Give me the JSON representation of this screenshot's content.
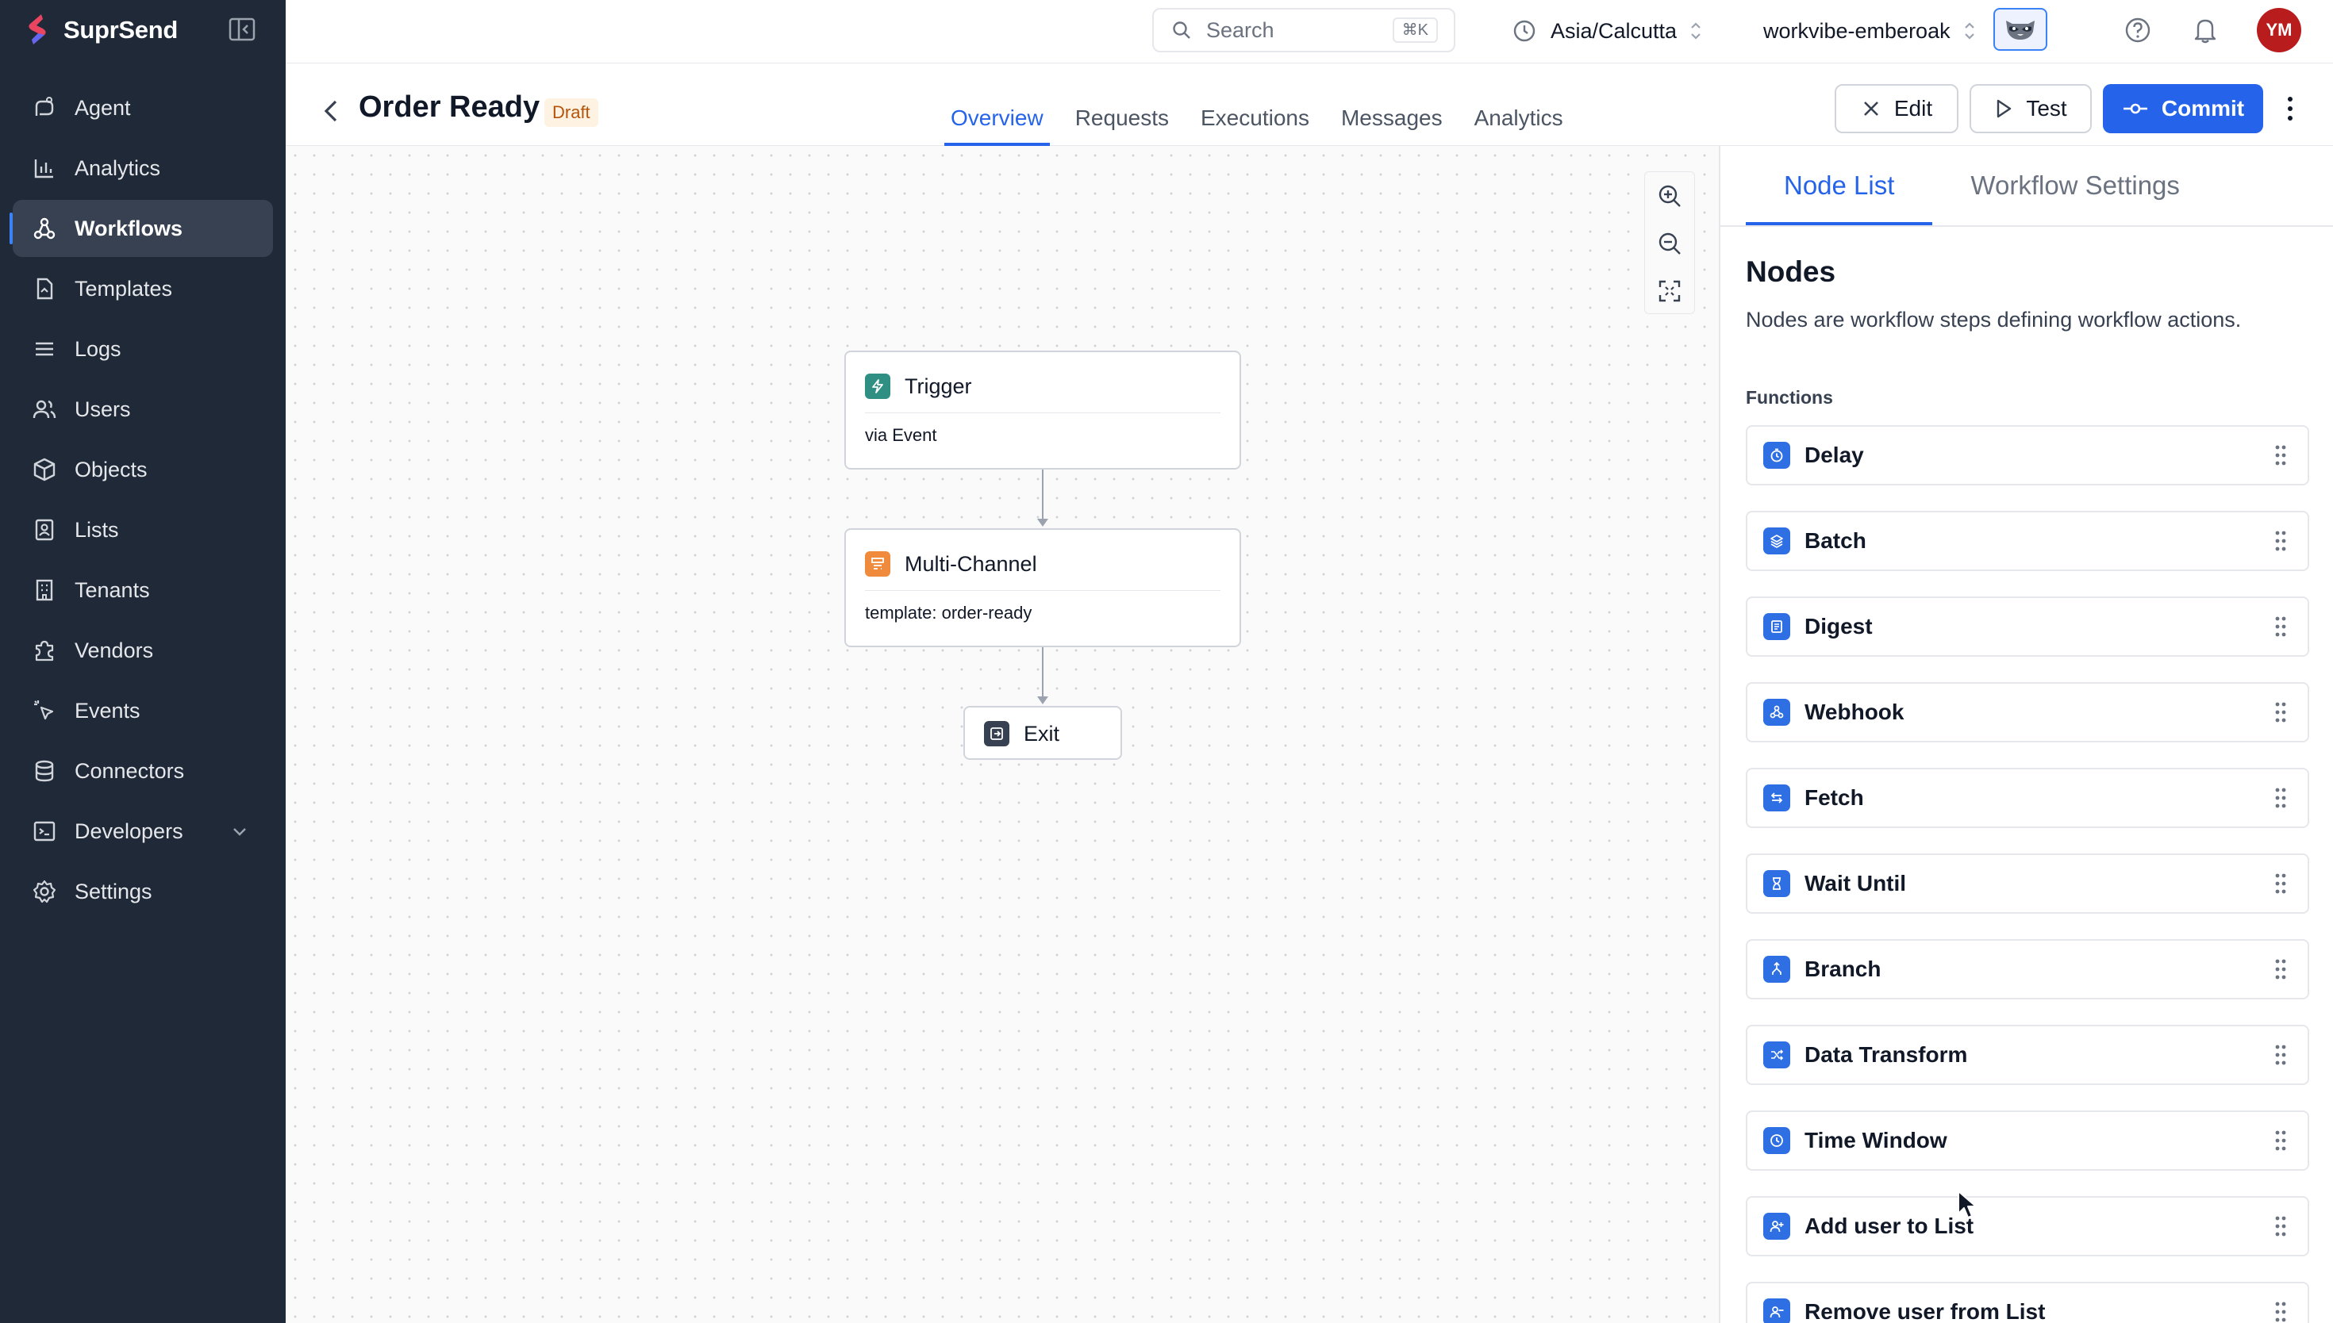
{
  "app": {
    "brand": "SuprSend"
  },
  "sidebar": {
    "items": [
      {
        "label": "Agent",
        "icon": "agent-icon",
        "active": false
      },
      {
        "label": "Analytics",
        "icon": "bar-chart-icon",
        "active": false
      },
      {
        "label": "Workflows",
        "icon": "workflow-icon",
        "active": true
      },
      {
        "label": "Templates",
        "icon": "template-icon",
        "active": false
      },
      {
        "label": "Logs",
        "icon": "list-icon",
        "active": false
      },
      {
        "label": "Users",
        "icon": "users-icon",
        "active": false
      },
      {
        "label": "Objects",
        "icon": "cube-icon",
        "active": false
      },
      {
        "label": "Lists",
        "icon": "contact-list-icon",
        "active": false
      },
      {
        "label": "Tenants",
        "icon": "building-icon",
        "active": false
      },
      {
        "label": "Vendors",
        "icon": "puzzle-icon",
        "active": false
      },
      {
        "label": "Events",
        "icon": "cursor-click-icon",
        "active": false
      },
      {
        "label": "Connectors",
        "icon": "database-icon",
        "active": false
      },
      {
        "label": "Developers",
        "icon": "terminal-icon",
        "active": false
      },
      {
        "label": "Settings",
        "icon": "gear-icon",
        "active": false
      }
    ]
  },
  "topbar": {
    "search_placeholder": "Search",
    "search_shortcut": "⌘K",
    "timezone": "Asia/Calcutta",
    "workspace": "workvibe-emberoak",
    "avatar_initials": "YM"
  },
  "page": {
    "title": "Order Ready",
    "status": "Draft",
    "tabs": [
      "Overview",
      "Requests",
      "Executions",
      "Messages",
      "Analytics"
    ],
    "active_tab": "Overview",
    "edit_label": "Edit",
    "test_label": "Test",
    "commit_label": "Commit"
  },
  "canvas": {
    "trigger": {
      "title": "Trigger",
      "subtitle": "via Event"
    },
    "multichannel": {
      "title": "Multi-Channel",
      "subtitle": "template: order-ready"
    },
    "exit": {
      "title": "Exit"
    }
  },
  "panel": {
    "tabs": [
      "Node List",
      "Workflow Settings"
    ],
    "active_tab": "Node List",
    "title": "Nodes",
    "description": "Nodes are workflow steps defining workflow actions.",
    "section": "Functions",
    "functions": [
      "Delay",
      "Batch",
      "Digest",
      "Webhook",
      "Fetch",
      "Wait Until",
      "Branch",
      "Data Transform",
      "Time Window",
      "Add user to List",
      "Remove user from List"
    ]
  },
  "colors": {
    "sidebar_bg": "#1f2937",
    "accent": "#2563eb",
    "draft_bg": "#fef3e2",
    "draft_text": "#b45309",
    "avatar_bg": "#b91c1c",
    "trigger_icon": "#2f8f83",
    "multichannel_icon": "#f08a3c"
  }
}
